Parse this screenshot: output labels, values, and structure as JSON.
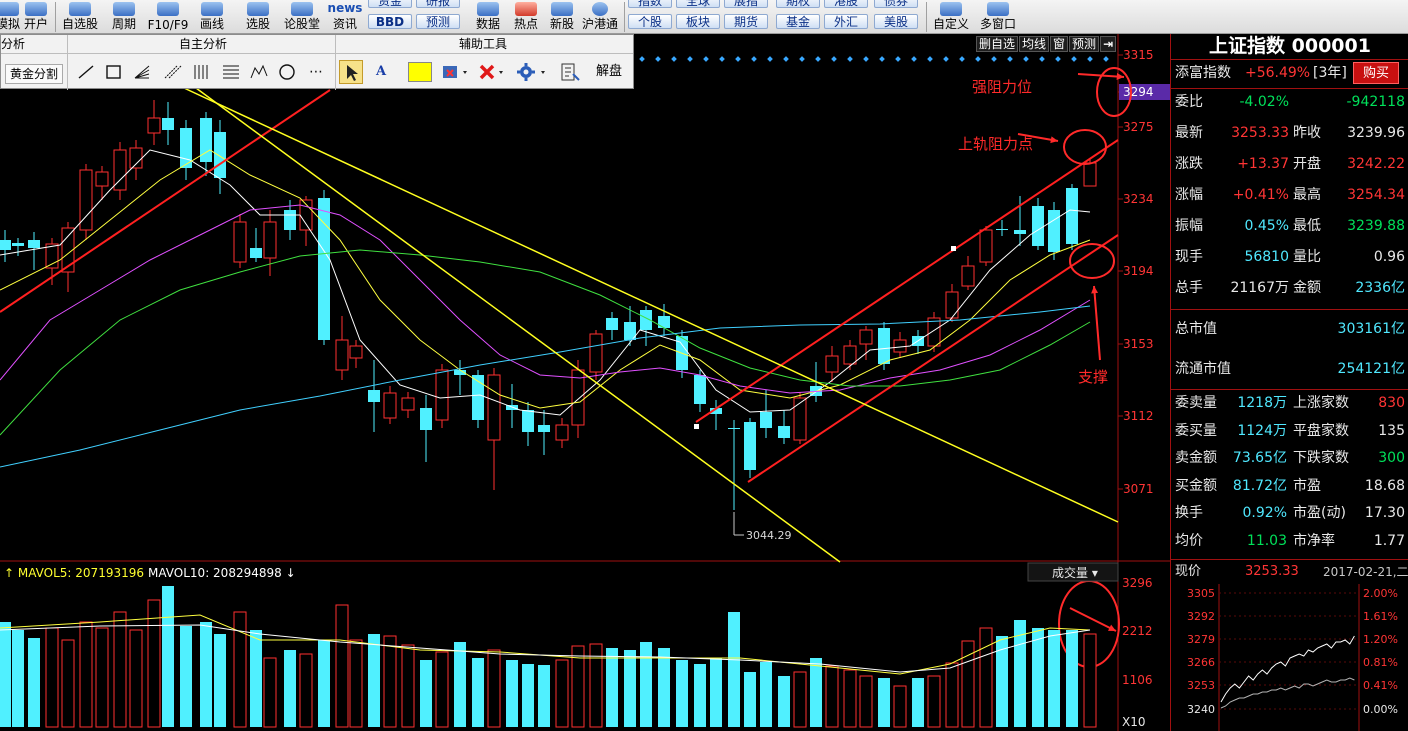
{
  "toolbar": {
    "big_buttons": [
      {
        "label": "模拟",
        "icon": "simulate-icon"
      },
      {
        "label": "开户",
        "icon": "open-account-icon"
      },
      {
        "label": "自选股",
        "icon": "favorites-icon"
      },
      {
        "label": "周期",
        "icon": "period-icon"
      },
      {
        "label": "F10/F9",
        "icon": "f10-icon"
      },
      {
        "label": "画线",
        "icon": "draw-line-icon"
      },
      {
        "label": "选股",
        "icon": "stock-picker-icon"
      },
      {
        "label": "论股堂",
        "icon": "forum-icon"
      },
      {
        "label": "资讯",
        "icon": "news-icon"
      },
      {
        "label": "数据",
        "icon": "data-icon"
      },
      {
        "label": "热点",
        "icon": "hot-icon"
      },
      {
        "label": "新股",
        "icon": "ipo-icon"
      },
      {
        "label": "沪港通",
        "icon": "hk-connect-icon"
      },
      {
        "label": "自定义",
        "icon": "custom-icon"
      },
      {
        "label": "多窗口",
        "icon": "multi-window-icon"
      }
    ],
    "news_logo": "news",
    "pills": [
      "资金",
      "研报",
      "BBD",
      "预测",
      "个股",
      "板块",
      "期货",
      "基金",
      "外汇",
      "美股",
      "指数",
      "全球",
      "展指",
      "期权",
      "港股",
      "债券"
    ]
  },
  "draw_panel": {
    "tabs": [
      "分析",
      "自主分析",
      "辅助工具"
    ],
    "gold_split": "黄金分割",
    "unlock": "解盘",
    "font_tool": "A"
  },
  "view_buttons": [
    "删自选",
    "均线",
    "窗",
    "预测"
  ],
  "price_axis": [
    "3315",
    "3294",
    "3275",
    "3234",
    "3194",
    "3153",
    "3112",
    "3071"
  ],
  "volume_axis": [
    "3296",
    "2212",
    "1106",
    "X10"
  ],
  "annotations": {
    "strong_resistance": "强阻力位",
    "upper_rail_resistance": "上轨阻力点",
    "support": "支撑",
    "low_price": "3044.29"
  },
  "volume_panel": {
    "mavol5": "MAVOL5: 207193196",
    "mavol10": "MAVOL10: 208294898",
    "dropdown": "成交量"
  },
  "quote": {
    "title": "上证指数 000001",
    "tianfu_label": "添富指数",
    "tianfu_value": "+56.49%",
    "tianfu_period": "[3年]",
    "buy_button": "购买",
    "rows": [
      {
        "l1": "委比",
        "v1": "-4.02%",
        "l2": "",
        "v2": "-942118"
      },
      {
        "l1": "最新",
        "v1": "3253.33",
        "l2": "昨收",
        "v2": "3239.96"
      },
      {
        "l1": "涨跌",
        "v1": "+13.37",
        "l2": "开盘",
        "v2": "3242.22"
      },
      {
        "l1": "涨幅",
        "v1": "+0.41%",
        "l2": "最高",
        "v2": "3254.34"
      },
      {
        "l1": "振幅",
        "v1": "0.45%",
        "l2": "最低",
        "v2": "3239.88"
      },
      {
        "l1": "现手",
        "v1": "56810",
        "l2": "量比",
        "v2": "0.96"
      },
      {
        "l1": "总手",
        "v1": "21167万",
        "l2": "金额",
        "v2": "2336亿"
      }
    ],
    "market_cap": {
      "label": "总市值",
      "value": "303161亿"
    },
    "float_cap": {
      "label": "流通市值",
      "value": "254121亿"
    },
    "breadth": [
      {
        "l1": "委卖量",
        "v1": "1218万",
        "l2": "上涨家数",
        "v2": "830"
      },
      {
        "l1": "委买量",
        "v1": "1124万",
        "l2": "平盘家数",
        "v2": "135"
      },
      {
        "l1": "卖金额",
        "v1": "73.65亿",
        "l2": "下跌家数",
        "v2": "300"
      },
      {
        "l1": "买金额",
        "v1": "81.72亿",
        "l2": "市盈",
        "v2": "18.68"
      },
      {
        "l1": "换手",
        "v1": "0.92%",
        "l2": "市盈(动)",
        "v2": "17.30"
      },
      {
        "l1": "均价",
        "v1": "11.03",
        "l2": "市净率",
        "v2": "1.77"
      }
    ],
    "now_label": "现价",
    "now_value": "3253.33",
    "date": "2017-02-21,二",
    "mini_left_axis": [
      "3305",
      "3292",
      "3279",
      "3266",
      "3253",
      "3240"
    ],
    "mini_right_axis": [
      "2.00%",
      "1.61%",
      "1.20%",
      "0.81%",
      "0.41%",
      "0.00%"
    ]
  },
  "colors": {
    "up": "#ff3030",
    "down": "#50f0ff",
    "channel": "#ff2020",
    "trend": "#ffff20",
    "annotation": "#ff2a2a"
  }
}
